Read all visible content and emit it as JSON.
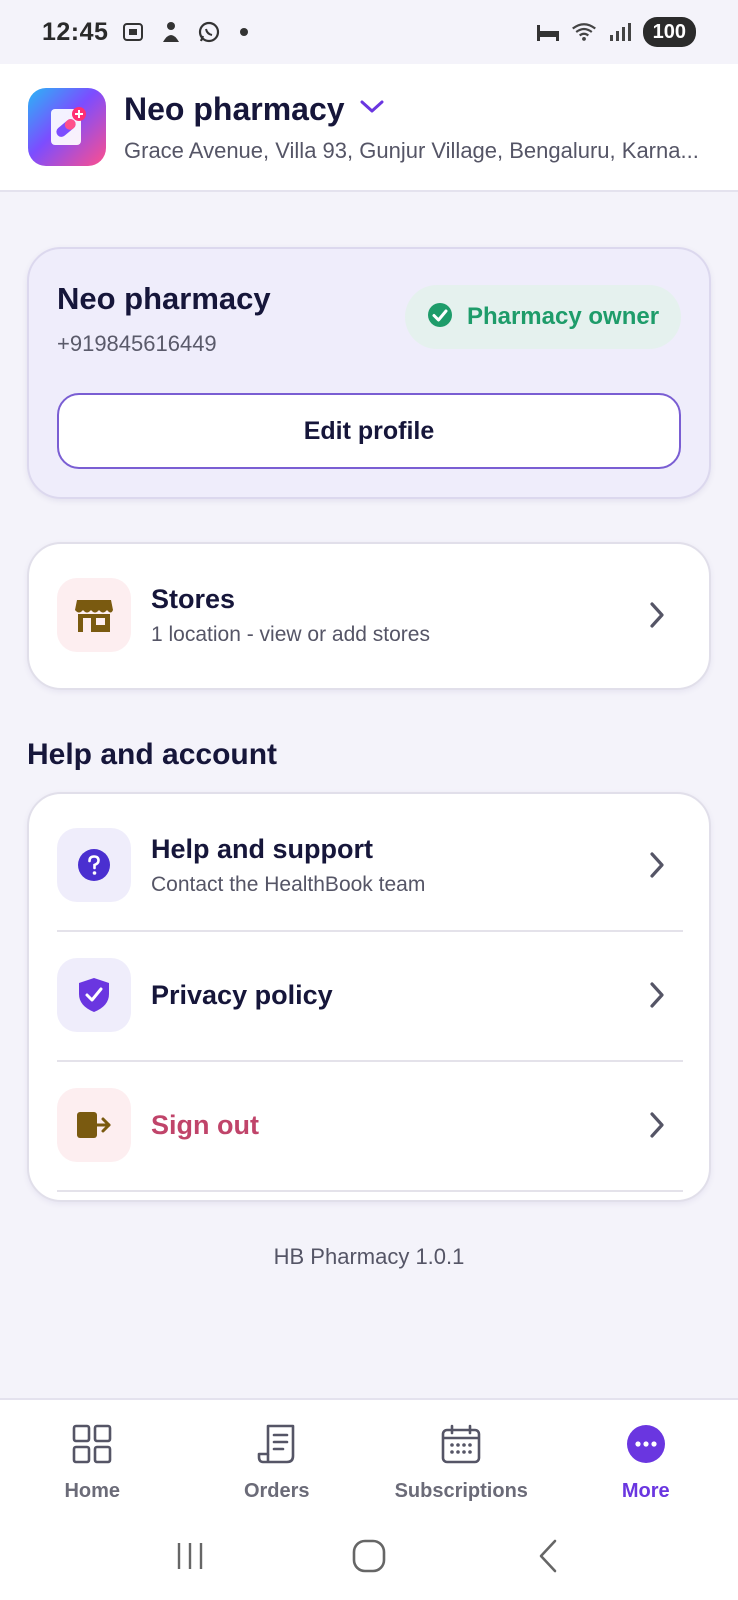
{
  "status_bar": {
    "time": "12:45",
    "battery": "100"
  },
  "header": {
    "store_name": "Neo pharmacy",
    "address": "Grace Avenue, Villa 93, Gunjur Village, Bengaluru, Karna..."
  },
  "profile": {
    "name": "Neo pharmacy",
    "phone": "+919845616449",
    "role_badge": "Pharmacy owner",
    "edit_label": "Edit profile"
  },
  "stores": {
    "title": "Stores",
    "subtitle": "1 location - view or add stores"
  },
  "help_section": {
    "title": "Help and account",
    "items": [
      {
        "title": "Help and support",
        "subtitle": "Contact the HealthBook team"
      },
      {
        "title": "Privacy policy"
      },
      {
        "title": "Sign out"
      }
    ]
  },
  "version": "HB Pharmacy 1.0.1",
  "bottom_nav": {
    "items": [
      {
        "label": "Home"
      },
      {
        "label": "Orders"
      },
      {
        "label": "Subscriptions"
      },
      {
        "label": "More"
      }
    ],
    "active": "More"
  },
  "colors": {
    "accent": "#6a36e0",
    "success": "#1e9c6a",
    "danger": "#c0446a",
    "text_primary": "#16163a"
  }
}
